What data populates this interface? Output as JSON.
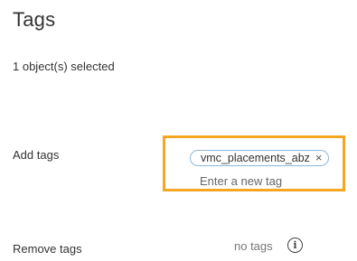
{
  "dialog": {
    "title": "Tags",
    "selected_count_text": "1 object(s) selected"
  },
  "add_tags": {
    "label": "Add tags",
    "tags": [
      {
        "label": "vmc_placements_abz",
        "remove_icon": "×"
      }
    ],
    "input_placeholder": "Enter a new tag",
    "highlight_color": "#f5a623"
  },
  "remove_tags": {
    "label": "Remove tags",
    "empty_text": "no tags",
    "info_icon": "i"
  }
}
